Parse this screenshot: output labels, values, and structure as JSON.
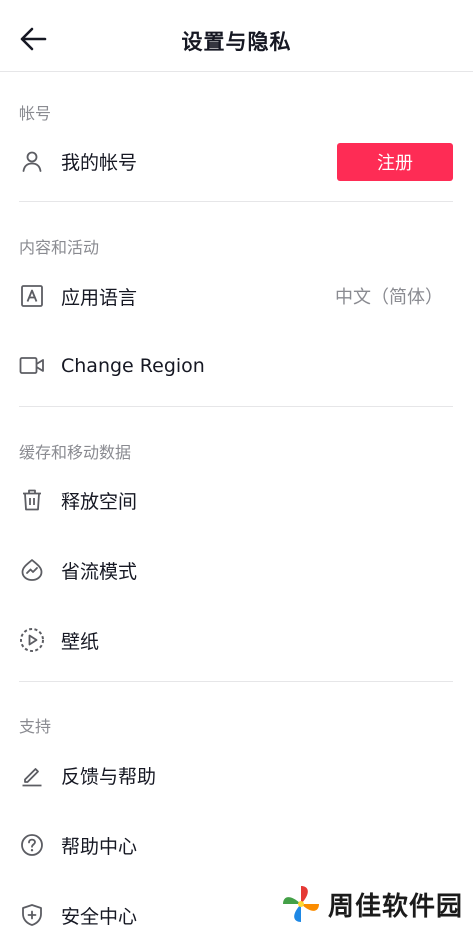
{
  "header": {
    "title": "设置与隐私",
    "back_icon": "arrow-left-icon"
  },
  "sections": {
    "account": {
      "title": "帐号",
      "my_account": {
        "label": "我的帐号",
        "icon": "person-icon",
        "button_label": "注册"
      }
    },
    "content": {
      "title": "内容和活动",
      "app_language": {
        "label": "应用语言",
        "value": "中文（简体）",
        "icon": "language-icon"
      },
      "change_region": {
        "label": "Change Region",
        "icon": "video-camera-icon"
      }
    },
    "cache": {
      "title": "缓存和移动数据",
      "free_space": {
        "label": "释放空间",
        "icon": "trash-icon"
      },
      "data_saver": {
        "label": "省流模式",
        "icon": "data-saver-icon"
      },
      "wallpaper": {
        "label": "壁纸",
        "icon": "play-circle-icon"
      }
    },
    "support": {
      "title": "支持",
      "feedback": {
        "label": "反馈与帮助",
        "icon": "pencil-icon"
      },
      "help_center": {
        "label": "帮助中心",
        "icon": "question-circle-icon"
      },
      "safety_center": {
        "label": "安全中心",
        "icon": "shield-plus-icon"
      }
    }
  },
  "watermark": {
    "text": "周佳软件园"
  },
  "colors": {
    "accent": "#fe2c55",
    "text": "#161823",
    "muted": "#8a8b91",
    "divider": "#e6e6e8"
  }
}
